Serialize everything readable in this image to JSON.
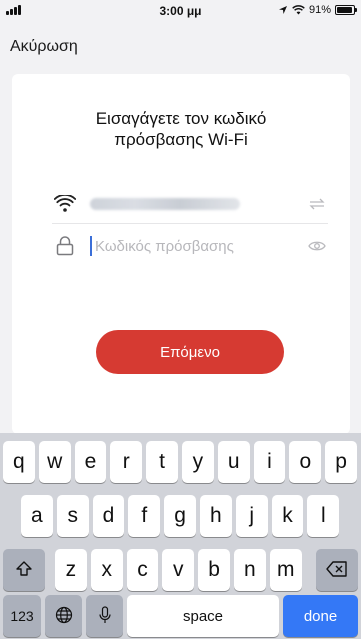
{
  "status": {
    "time": "3:00 μμ",
    "battery": "91%",
    "battery_level": 0.91
  },
  "nav": {
    "cancel": "Ακύρωση"
  },
  "card": {
    "title_line1": "Εισαγάγετε τον κωδικό",
    "title_line2": "πρόσβασης Wi-Fi",
    "password_placeholder": "Κωδικός πρόσβασης",
    "next_button": "Επόμενο"
  },
  "keyboard": {
    "row1": [
      "q",
      "w",
      "e",
      "r",
      "t",
      "y",
      "u",
      "i",
      "o",
      "p"
    ],
    "row2": [
      "a",
      "s",
      "d",
      "f",
      "g",
      "h",
      "j",
      "k",
      "l"
    ],
    "row3": [
      "z",
      "x",
      "c",
      "v",
      "b",
      "n",
      "m"
    ],
    "numbers_key": "123",
    "space_key": "space",
    "done_key": "done"
  },
  "colors": {
    "accent_red": "#d63a32",
    "done_blue": "#3478f6",
    "keyboard_bg": "#d1d3d9"
  },
  "icons": {
    "wifi": "wifi-icon",
    "lock": "lock-icon",
    "switch": "switch-network-icon",
    "eye": "show-password-icon",
    "shift": "shift-icon",
    "backspace": "backspace-icon",
    "globe": "globe-icon",
    "mic": "microphone-icon"
  }
}
